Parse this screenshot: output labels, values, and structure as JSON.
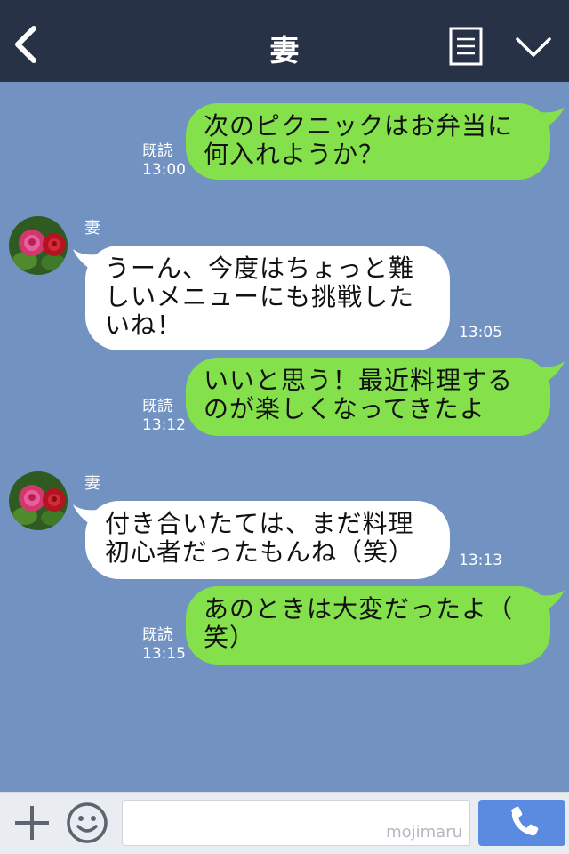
{
  "header": {
    "title": "妻",
    "back_icon": "chevron-left-icon",
    "menu_icon": "notes-icon",
    "collapse_icon": "chevron-down-icon",
    "background_color": "#273246"
  },
  "chat": {
    "background_color": "#7293c2",
    "sent_bubble_color": "#84e04b",
    "received_bubble_color": "#ffffff",
    "messages": [
      {
        "direction": "sent",
        "line1": "次のピクニックはお弁当に",
        "line2": "何入れようか？",
        "read_label": "既読",
        "time": "13:00"
      },
      {
        "direction": "received",
        "sender": "妻",
        "line1": "うーん、今度はちょっと難",
        "line2": "しいメニューにも挑戦した",
        "line3": "いね！",
        "time": "13:05"
      },
      {
        "direction": "sent",
        "line1": "いいと思う！最近料理する",
        "line2": "のが楽しくなってきたよ",
        "read_label": "既読",
        "time": "13:12"
      },
      {
        "direction": "received",
        "sender": "妻",
        "line1": "付き合いたては、まだ料理",
        "line2": "初心者だったもんね（笑）",
        "time": "13:13"
      },
      {
        "direction": "sent",
        "line1": "あのときは大変だったよ（",
        "line2": "笑）",
        "read_label": "既読",
        "time": "13:15"
      }
    ]
  },
  "input_bar": {
    "plus_icon": "plus-icon",
    "emoji_icon": "smiley-icon",
    "watermark": "mojimaru",
    "call_icon": "phone-icon",
    "call_button_color": "#5b8be0"
  }
}
